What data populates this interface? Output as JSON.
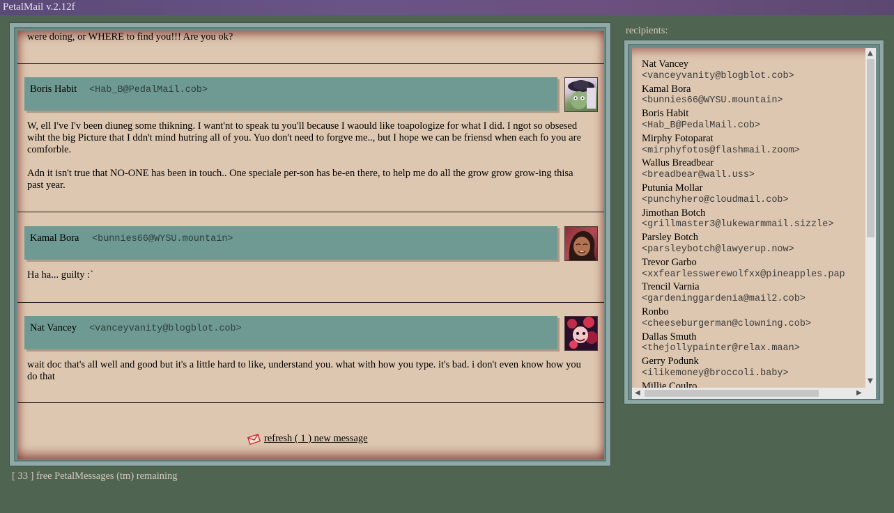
{
  "window": {
    "title": "PetalMail v.2.12f"
  },
  "thread": {
    "top_fragment": "were doing, or WHERE to find you!!! Are you ok?",
    "messages": [
      {
        "sender": "Boris Habit",
        "email": "<Hab_B@PedalMail.cob>",
        "paragraphs": [
          "W, ell I've I'v been diuneg some thikning. I want'nt to speak tu you'll because I waould like toapologize for what I did. I ngot so obsesed wiht the big Picture that I ddn't mind hutring all of you. Yuo don't need to forgve me.., but I hope we can be friensd when each fo you are comforble.",
          "Adn it isn't true that NO-ONE has been in touch.. One speciale per-son has be-en there, to help me do all the grow grow grow-ing thisa past year."
        ]
      },
      {
        "sender": "Kamal Bora",
        "email": "<bunnies66@WYSU.mountain>",
        "paragraphs": [
          "Ha ha... guilty :`"
        ]
      },
      {
        "sender": "Nat Vancey",
        "email": "<vanceyvanity@blogblot.cob>",
        "paragraphs": [
          "wait doc that's all well and good but it's a little hard to like, understand you. what with how you type. it's bad. i don't even know how you do that"
        ]
      }
    ]
  },
  "refresh": {
    "label": " refresh ( 1 ) new message",
    "icon": "envelope-icon"
  },
  "footer": {
    "text": "[ 33 ] free PetalMessages (tm) remaining"
  },
  "recipients": {
    "label": "recipients:",
    "items": [
      {
        "name": "Nat Vancey",
        "email": "<vanceyvanity@blogblot.cob>"
      },
      {
        "name": "Kamal Bora",
        "email": "<bunnies66@WYSU.mountain>"
      },
      {
        "name": "Boris Habit",
        "email": "<Hab_B@PedalMail.cob>"
      },
      {
        "name": "Mirphy Fotoparat",
        "email": "<mirphyfotos@flashmail.zoom>"
      },
      {
        "name": "Wallus Breadbear",
        "email": "<breadbear@wall.uss>"
      },
      {
        "name": "Putunia Mollar",
        "email": "<punchyhero@cloudmail.cob>"
      },
      {
        "name": "Jimothan Botch",
        "email": "<grillmaster3@lukewarmmail.sizzle>"
      },
      {
        "name": "Parsley Botch",
        "email": "<parsleybotch@lawyerup.now>"
      },
      {
        "name": "Trevor Garbo",
        "email": "<xxfearlesswerewolfxx@pineapples.pap"
      },
      {
        "name": "Trencil Varnia",
        "email": "<gardeninggardenia@mail2.cob>"
      },
      {
        "name": "Ronbo",
        "email": "<cheeseburgerman@clowning.cob>"
      },
      {
        "name": "Dallas Smuth",
        "email": "<thejollypainter@relax.maan>"
      },
      {
        "name": "Gerry Podunk",
        "email": "<ilikemoney@broccoli.baby>"
      },
      {
        "name": "Millie Coulro",
        "email": ""
      }
    ]
  }
}
